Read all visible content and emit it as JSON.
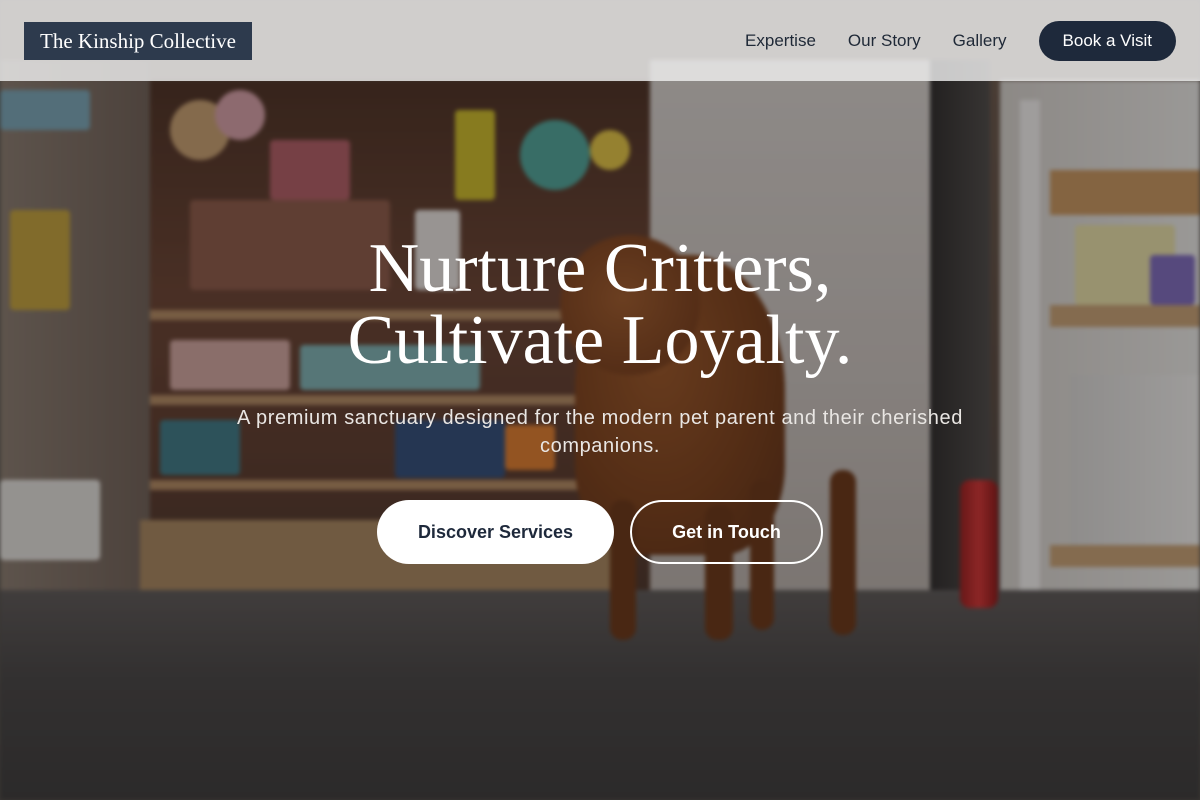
{
  "brand": {
    "name": "The Kinship Collective"
  },
  "nav": {
    "links": [
      {
        "label": "Expertise"
      },
      {
        "label": "Our Story"
      },
      {
        "label": "Gallery"
      }
    ],
    "cta_label": "Book a Visit"
  },
  "hero": {
    "headline_line1": "Nurture Critters,",
    "headline_line2": "Cultivate Loyalty.",
    "subtitle": "A premium sanctuary designed for the modern pet parent and their cherished companions.",
    "primary_cta": "Discover Services",
    "secondary_cta": "Get in Touch",
    "background_image": "pet-shop-puppy-photo"
  },
  "colors": {
    "brand_navy": "#1e293b",
    "logo_bg": "#2d3a4d",
    "header_bg": "#eeeeee",
    "hero_text": "#ffffff"
  }
}
